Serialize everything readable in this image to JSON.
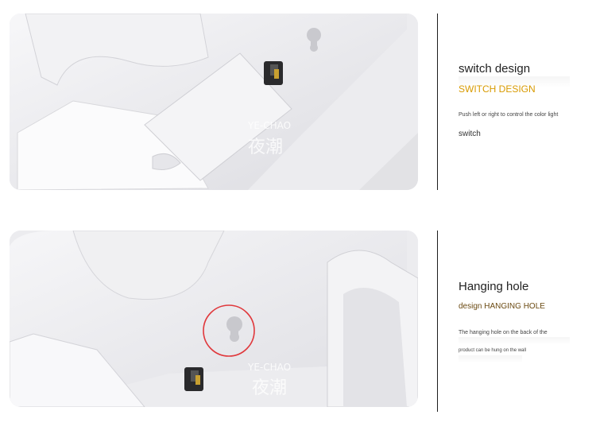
{
  "watermark": {
    "latin": "YE-CHAO",
    "cjk": "夜潮"
  },
  "sections": [
    {
      "title": "switch design",
      "subtitle": "SWITCH DESIGN",
      "description": "Push left or right to control the color light",
      "extra": "switch"
    },
    {
      "title": "Hanging hole",
      "subtitle": "design HANGING HOLE",
      "description_line1": "The hanging hole on the back of the",
      "description_line2": "product can be hung on the wall"
    }
  ],
  "colors": {
    "highlight_circle": "#e0383c",
    "subtitle_yellow": "#d89a00",
    "divider": "#1c1c1c"
  }
}
